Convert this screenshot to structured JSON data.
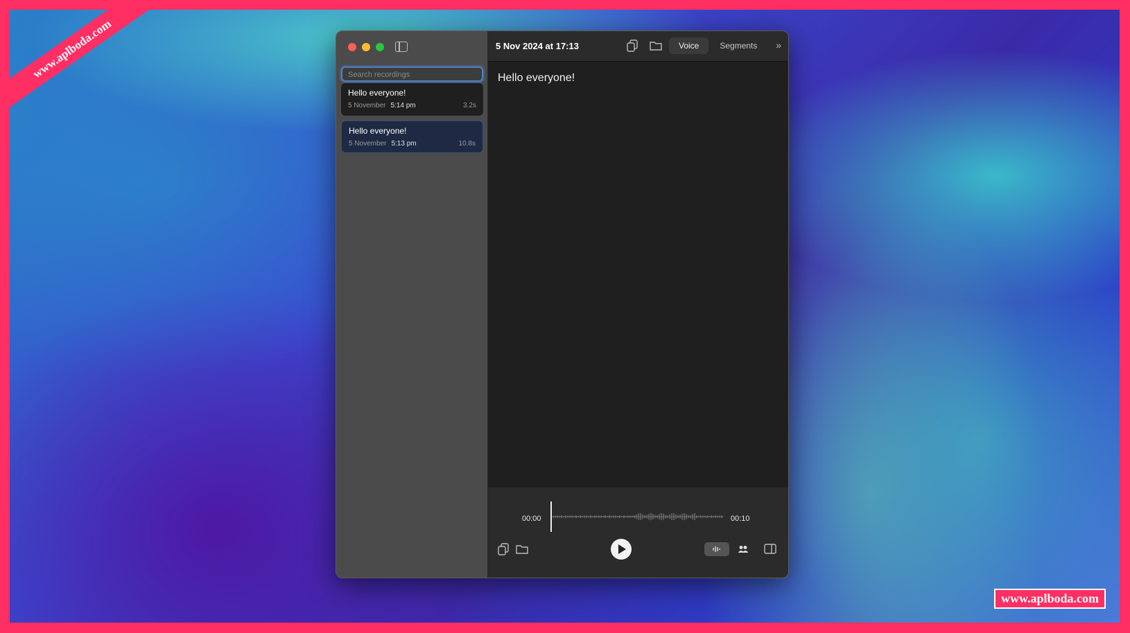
{
  "watermark": {
    "stripe_text": "www.aplboda.com",
    "badge_text": "www.aplboda.com"
  },
  "sidebar": {
    "search_placeholder": "Search recordings",
    "recordings": [
      {
        "title": "Hello everyone!",
        "date": "5 November",
        "time": "5:14 pm",
        "duration": "3.2s"
      },
      {
        "title": "Hello everyone!",
        "date": "5 November",
        "time": "5:13 pm",
        "duration": "10.8s"
      }
    ]
  },
  "header": {
    "title": "5 Nov 2024 at 17:13",
    "tabs": [
      "Voice",
      "Segments"
    ],
    "active_tab": "Voice"
  },
  "transcript": {
    "text": "Hello everyone!"
  },
  "player": {
    "start": "00:00",
    "end": "00:10",
    "progress": 0
  },
  "colors": {
    "accent": "#4e7fc2",
    "window": "#1f1f1f",
    "sidebar": "#4b4b4b"
  }
}
